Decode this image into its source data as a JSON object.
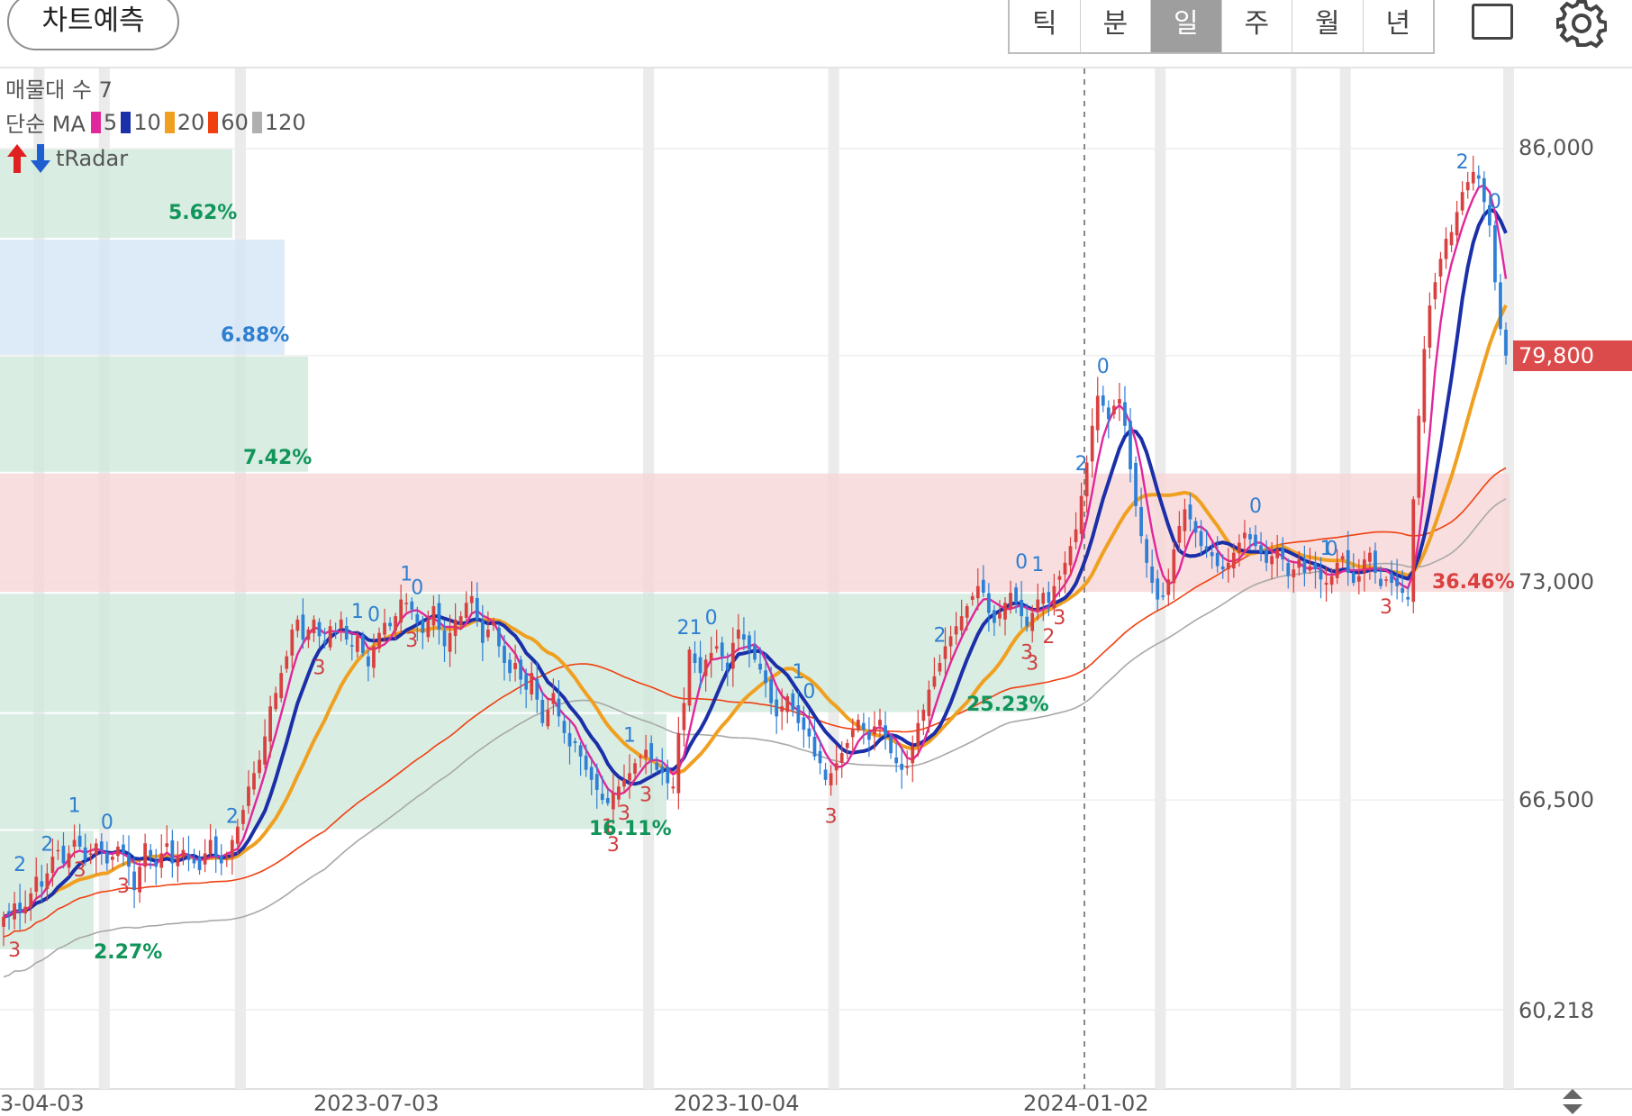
{
  "toolbar": {
    "predict_label": "차트예측",
    "periods": [
      "틱",
      "분",
      "일",
      "주",
      "월",
      "년"
    ],
    "active_period": "일",
    "square_icon": "square-icon",
    "settings_icon": "gear-icon"
  },
  "legend": {
    "volume_profile": "매물대 수 7",
    "ma_prefix": "단순 MA",
    "ma": [
      {
        "period": "5",
        "color": "#e0279b"
      },
      {
        "period": "10",
        "color": "#1b2fa8"
      },
      {
        "period": "20",
        "color": "#f0a020"
      },
      {
        "period": "60",
        "color": "#f04010"
      },
      {
        "period": "120",
        "color": "#b0b0b0"
      }
    ],
    "radar": "tRadar"
  },
  "colors": {
    "up": "#d94040",
    "down": "#2e7fd6",
    "zone_green": "#dcefe6",
    "zone_blue": "#dbeafa",
    "zone_red": "#f8dede"
  },
  "chart_data": {
    "type": "candlestick",
    "x_ticks": [
      "3-04-03",
      "2023-07-03",
      "2023-10-04",
      "2024-01-02"
    ],
    "y_ticks": [
      "86,000",
      "73,000",
      "66,500",
      "60,218"
    ],
    "ylim": [
      60218,
      86000
    ],
    "last_price": "79,800",
    "last_value": 79800,
    "volume_profile": [
      {
        "low": 83300,
        "high": 86000,
        "label": "5.62%",
        "color": "green"
      },
      {
        "low": 79800,
        "high": 83300,
        "label": "6.88%",
        "color": "blue"
      },
      {
        "low": 76300,
        "high": 79800,
        "label": "7.42%",
        "color": "green"
      },
      {
        "low": 72700,
        "high": 76300,
        "label": "36.46%",
        "color": "red"
      },
      {
        "low": 69100,
        "high": 72700,
        "label": "25.23%",
        "color": "green"
      },
      {
        "low": 65600,
        "high": 69100,
        "label": "16.11%",
        "color": "green"
      },
      {
        "low": 62000,
        "high": 65600,
        "label": "2.27%",
        "color": "green"
      }
    ],
    "close_series": [
      63000,
      63100,
      63400,
      63150,
      63300,
      63700,
      64200,
      63900,
      64300,
      64800,
      65000,
      64600,
      64900,
      65300,
      65100,
      64700,
      64900,
      65200,
      65000,
      64600,
      64800,
      65100,
      64900,
      64500,
      63800,
      64500,
      65200,
      64800,
      64500,
      64900,
      65200,
      64600,
      64800,
      65000,
      64700,
      64600,
      64400,
      64900,
      65300,
      64800,
      64600,
      64800,
      65300,
      65700,
      66200,
      66900,
      67300,
      67700,
      68400,
      69300,
      69700,
      70300,
      70800,
      71600,
      71900,
      71300,
      71600,
      71900,
      71400,
      71200,
      71700,
      71500,
      71900,
      71300,
      71100,
      71400,
      70900,
      70500,
      71100,
      71500,
      71800,
      71700,
      72000,
      72500,
      72400,
      72200,
      71800,
      71500,
      71900,
      72300,
      71600,
      71100,
      71500,
      71900,
      72000,
      72400,
      72600,
      71900,
      71200,
      71600,
      71800,
      71100,
      70600,
      70300,
      70600,
      70100,
      69800,
      70300,
      69500,
      68800,
      69200,
      69700,
      69000,
      68500,
      68100,
      68200,
      67800,
      67400,
      67100,
      66800,
      66500,
      66400,
      66700,
      66900,
      67100,
      67300,
      67600,
      67800,
      68000,
      67700,
      67400,
      67300,
      67000,
      66900,
      68500,
      69400,
      71000,
      70600,
      70300,
      70700,
      70900,
      71100,
      70800,
      70400,
      71200,
      71600,
      71300,
      71000,
      70700,
      70400,
      70000,
      69400,
      69000,
      69300,
      69600,
      69200,
      68800,
      68600,
      68400,
      67800,
      67600,
      67100,
      67300,
      67600,
      67900,
      68200,
      68600,
      68900,
      68600,
      68300,
      68700,
      68900,
      68400,
      67900,
      67600,
      67400,
      67500,
      68100,
      68800,
      69200,
      69800,
      70200,
      70600,
      71100,
      71400,
      71700,
      72000,
      72300,
      72600,
      72900,
      72700,
      72100,
      71800,
      72100,
      72400,
      72700,
      72400,
      72000,
      71700,
      72100,
      72500,
      72700,
      72400,
      72900,
      73200,
      73600,
      74100,
      74600,
      75600,
      76600,
      77700,
      78600,
      78300,
      77900,
      78300,
      78500,
      77700,
      76400,
      75300,
      74400,
      73600,
      73000,
      72500,
      72600,
      73100,
      74000,
      74700,
      75200,
      74900,
      74500,
      74100,
      74000,
      73800,
      73500,
      73400,
      73600,
      73900,
      74200,
      74500,
      74300,
      74100,
      73900,
      73600,
      73800,
      74000,
      73700,
      73200,
      73400,
      73700,
      73300,
      73500,
      73400,
      73100,
      73000,
      73200,
      73600,
      73800,
      73300,
      73000,
      73200,
      73700,
      73900,
      73300,
      72900,
      73100,
      73000,
      72900,
      72700,
      72500,
      75500,
      78000,
      80000,
      81300,
      82000,
      82700,
      83300,
      83500,
      84100,
      84700,
      85000,
      85300,
      85100,
      84400,
      83700,
      82000,
      80600,
      79800
    ],
    "signals": [
      {
        "idx": 3,
        "text": "2",
        "type": "down"
      },
      {
        "idx": 8,
        "text": "2",
        "type": "down"
      },
      {
        "idx": 13,
        "text": "1",
        "type": "down"
      },
      {
        "idx": 19,
        "text": "0",
        "type": "down"
      },
      {
        "idx": 14,
        "text": "3",
        "type": "up"
      },
      {
        "idx": 22,
        "text": "3",
        "type": "up"
      },
      {
        "idx": 2,
        "text": "3",
        "type": "up"
      },
      {
        "idx": 42,
        "text": "2",
        "type": "down"
      },
      {
        "idx": 58,
        "text": "3",
        "type": "up"
      },
      {
        "idx": 65,
        "text": "1",
        "type": "down"
      },
      {
        "idx": 68,
        "text": "0",
        "type": "down"
      },
      {
        "idx": 74,
        "text": "1",
        "type": "down"
      },
      {
        "idx": 76,
        "text": "0",
        "type": "down"
      },
      {
        "idx": 75,
        "text": "3",
        "type": "up"
      },
      {
        "idx": 111,
        "text": "1",
        "type": "up"
      },
      {
        "idx": 112,
        "text": "3",
        "type": "up"
      },
      {
        "idx": 114,
        "text": "3",
        "type": "up"
      },
      {
        "idx": 115,
        "text": "1",
        "type": "down"
      },
      {
        "idx": 118,
        "text": "3",
        "type": "up"
      },
      {
        "idx": 126,
        "text": "21",
        "type": "down"
      },
      {
        "idx": 130,
        "text": "0",
        "type": "down"
      },
      {
        "idx": 146,
        "text": "1",
        "type": "down"
      },
      {
        "idx": 148,
        "text": "0",
        "type": "down"
      },
      {
        "idx": 152,
        "text": "3",
        "type": "up"
      },
      {
        "idx": 172,
        "text": "2",
        "type": "down"
      },
      {
        "idx": 187,
        "text": "0",
        "type": "down"
      },
      {
        "idx": 188,
        "text": "3",
        "type": "up"
      },
      {
        "idx": 189,
        "text": "3",
        "type": "up"
      },
      {
        "idx": 190,
        "text": "1",
        "type": "down"
      },
      {
        "idx": 192,
        "text": "2",
        "type": "up"
      },
      {
        "idx": 194,
        "text": "3",
        "type": "up"
      },
      {
        "idx": 198,
        "text": "2",
        "type": "down"
      },
      {
        "idx": 202,
        "text": "0",
        "type": "down"
      },
      {
        "idx": 230,
        "text": "0",
        "type": "down"
      },
      {
        "idx": 243,
        "text": "1",
        "type": "down"
      },
      {
        "idx": 244,
        "text": "0",
        "type": "down"
      },
      {
        "idx": 254,
        "text": "3",
        "type": "up"
      },
      {
        "idx": 268,
        "text": "2",
        "type": "down"
      },
      {
        "idx": 274,
        "text": "0",
        "type": "down"
      }
    ]
  }
}
